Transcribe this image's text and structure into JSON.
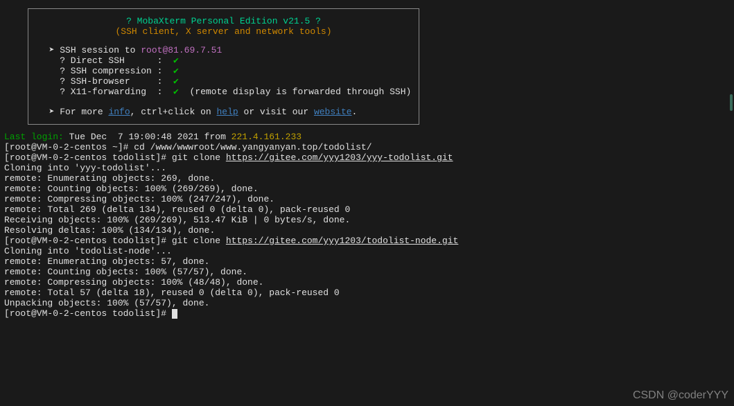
{
  "banner": {
    "title": "? MobaXterm Personal Edition v21.5 ?",
    "subtitle": "(SSH client, X server and network tools)",
    "session_prefix": "  ➤ SSH session to ",
    "session_target": "root@81.69.7.51",
    "items": [
      "    ? Direct SSH      :  ",
      "    ? SSH compression :  ",
      "    ? SSH-browser     :  ",
      "    ? X11-forwarding  :  "
    ],
    "check": "✔",
    "x11_suffix": "  (remote display is forwarded through SSH)",
    "more_prefix": "  ➤ For more ",
    "more_info": "info",
    "more_mid1": ", ctrl+click on ",
    "more_help": "help",
    "more_mid2": " or visit our ",
    "more_website": "website",
    "more_end": "."
  },
  "session": {
    "last_login_label": "Last login:",
    "last_login_time": " Tue Dec  7 19:00:48 2021 from ",
    "last_login_ip": "221.4.161.233",
    "prompt1": "[root@VM-0-2-centos ~]# ",
    "cmd1": "cd /www/wwwroot/www.yangyanyan.top/todolist/",
    "prompt2": "[root@VM-0-2-centos todolist]# ",
    "cmd2_prefix": "git clone ",
    "url1": "https://gitee.com/yyy1203/yyy-todolist.git",
    "out1": "Cloning into 'yyy-todolist'...",
    "out2": "remote: Enumerating objects: 269, done.",
    "out3": "remote: Counting objects: 100% (269/269), done.",
    "out4": "remote: Compressing objects: 100% (247/247), done.",
    "out5": "remote: Total 269 (delta 134), reused 0 (delta 0), pack-reused 0",
    "out6": "Receiving objects: 100% (269/269), 513.47 KiB | 0 bytes/s, done.",
    "out7": "Resolving deltas: 100% (134/134), done.",
    "prompt3": "[root@VM-0-2-centos todolist]# ",
    "cmd3_prefix": "git clone ",
    "url2": "https://gitee.com/yyy1203/todolist-node.git",
    "out8": "Cloning into 'todolist-node'...",
    "out9": "remote: Enumerating objects: 57, done.",
    "out10": "remote: Counting objects: 100% (57/57), done.",
    "out11": "remote: Compressing objects: 100% (48/48), done.",
    "out12": "remote: Total 57 (delta 18), reused 0 (delta 0), pack-reused 0",
    "out13": "Unpacking objects: 100% (57/57), done.",
    "prompt4": "[root@VM-0-2-centos todolist]# "
  },
  "watermark": "CSDN @coderYYY"
}
